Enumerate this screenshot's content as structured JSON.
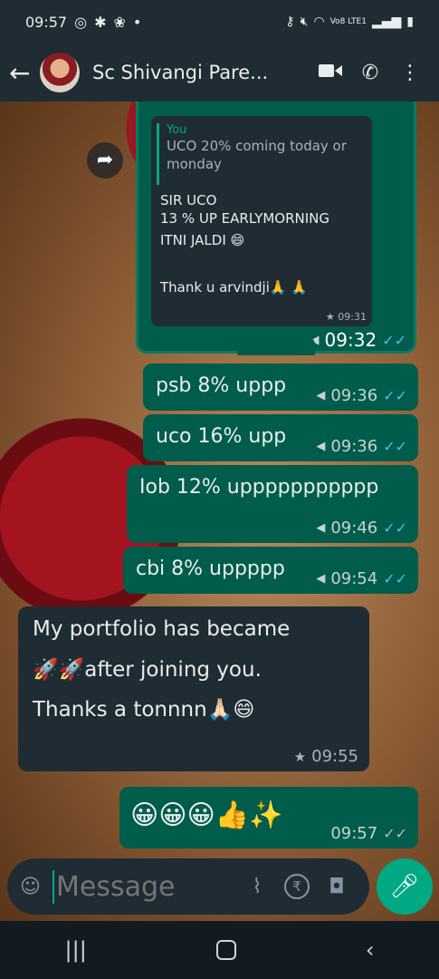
{
  "status_bar": {
    "time": "09:57",
    "network": "Vo8 LTE1"
  },
  "header": {
    "contact_name": "Sc Shivangi Pare..."
  },
  "forwarded_message": {
    "quote_author": "You",
    "quote_text": "UCO 20% coming today or monday",
    "body_line1": "SIR  UCO",
    "body_line2": "13 % UP EARLYMORNING",
    "body_line3": "ITNI JALDI 😄",
    "body_line4": "Thank u arvindji🙏 🙏",
    "inner_time": "09:31",
    "outer_time": "09:32"
  },
  "messages": [
    {
      "text": "psb 8% uppp",
      "time": "09:36"
    },
    {
      "text": "uco 16% upp",
      "time": "09:36"
    },
    {
      "text": "Iob 12% uppppppppppp",
      "time": "09:46"
    },
    {
      "text": "cbi 8% uppppp",
      "time": "09:54"
    }
  ],
  "incoming": {
    "line1": "My portfolio has became",
    "line2": "🚀🚀after joining  you.",
    "line3": "Thanks a tonnnn🙏🏻😄",
    "time": "09:55"
  },
  "last_message": {
    "text": "😀😀😀👍✨",
    "time": "09:57"
  },
  "composer": {
    "placeholder": "Message"
  },
  "icons": {
    "status": [
      "whatsapp-icon",
      "accessibility-icon",
      "gallery-icon",
      "dot-icon",
      "key-icon",
      "mute-icon",
      "wifi-icon",
      "signal-icon",
      "battery-icon"
    ],
    "header": [
      "back-arrow-icon",
      "video-call-icon",
      "phone-icon",
      "more-icon"
    ],
    "composer": [
      "emoji-icon",
      "attach-icon",
      "rupee-icon",
      "camera-icon",
      "mic-icon"
    ],
    "nav": [
      "recents-icon",
      "home-icon",
      "back-icon"
    ]
  },
  "colors": {
    "outgoing_bubble": "#005c4b",
    "incoming_bubble": "#1f2c34",
    "read_tick": "#53bdeb",
    "accent": "#00a884"
  }
}
